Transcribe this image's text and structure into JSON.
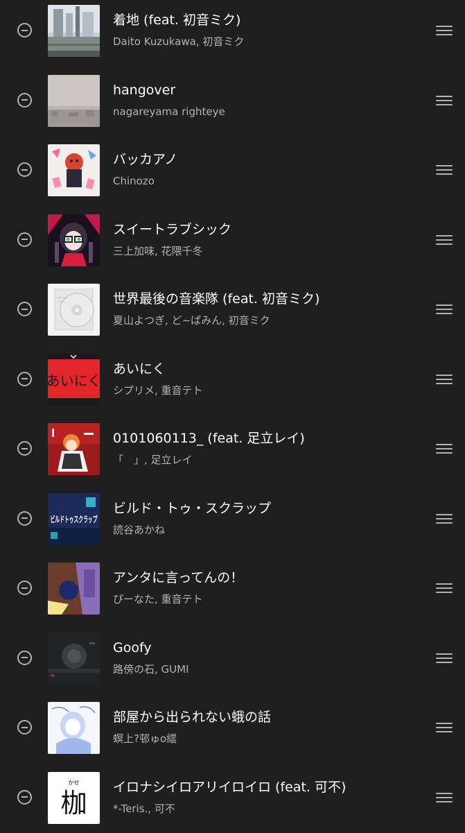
{
  "tracks": [
    {
      "title": "着地 (feat. 初音ミク)",
      "artist": "Daito Kuzukawa, 初音ミク"
    },
    {
      "title": "hangover",
      "artist": "nagareyama righteye"
    },
    {
      "title": "バッカアノ",
      "artist": "Chinozo"
    },
    {
      "title": "スイートラブシック",
      "artist": "三上加味, 花隈千冬"
    },
    {
      "title": "世界最後の音楽隊 (feat. 初音ミク)",
      "artist": "夏山よつぎ, ど~ぱみん, 初音ミク"
    },
    {
      "title": "あいにく",
      "artist": "シプリメ, 重音テト"
    },
    {
      "title": "0101060113_ (feat. 足立レイ)",
      "artist": "「　」, 足立レイ"
    },
    {
      "title": "ビルド・トゥ・スクラップ",
      "artist": "読谷あかね"
    },
    {
      "title": "アンタに言ってんの！",
      "artist": "ぴーなた, 重音テト"
    },
    {
      "title": "Goofy",
      "artist": "路傍の石, GUMI"
    },
    {
      "title": "部屋から出られない蛾の話",
      "artist": "螟上?邨ゅo繧"
    },
    {
      "title": "イロナシイロアリイロイロ (feat. 可不)",
      "artist": "*-Teris., 可不"
    }
  ],
  "art_text": {
    "aiiniku": "あいにく",
    "build": "ビルドトゥスクラップ",
    "kase_ruby": "かせ",
    "kase": "枷"
  },
  "icons": {
    "remove": "minus-circle-icon",
    "reorder": "drag-handle-icon"
  },
  "colors": {
    "background": "#1f1f1f",
    "title": "#ffffff",
    "secondary": "#b3b3b3"
  }
}
